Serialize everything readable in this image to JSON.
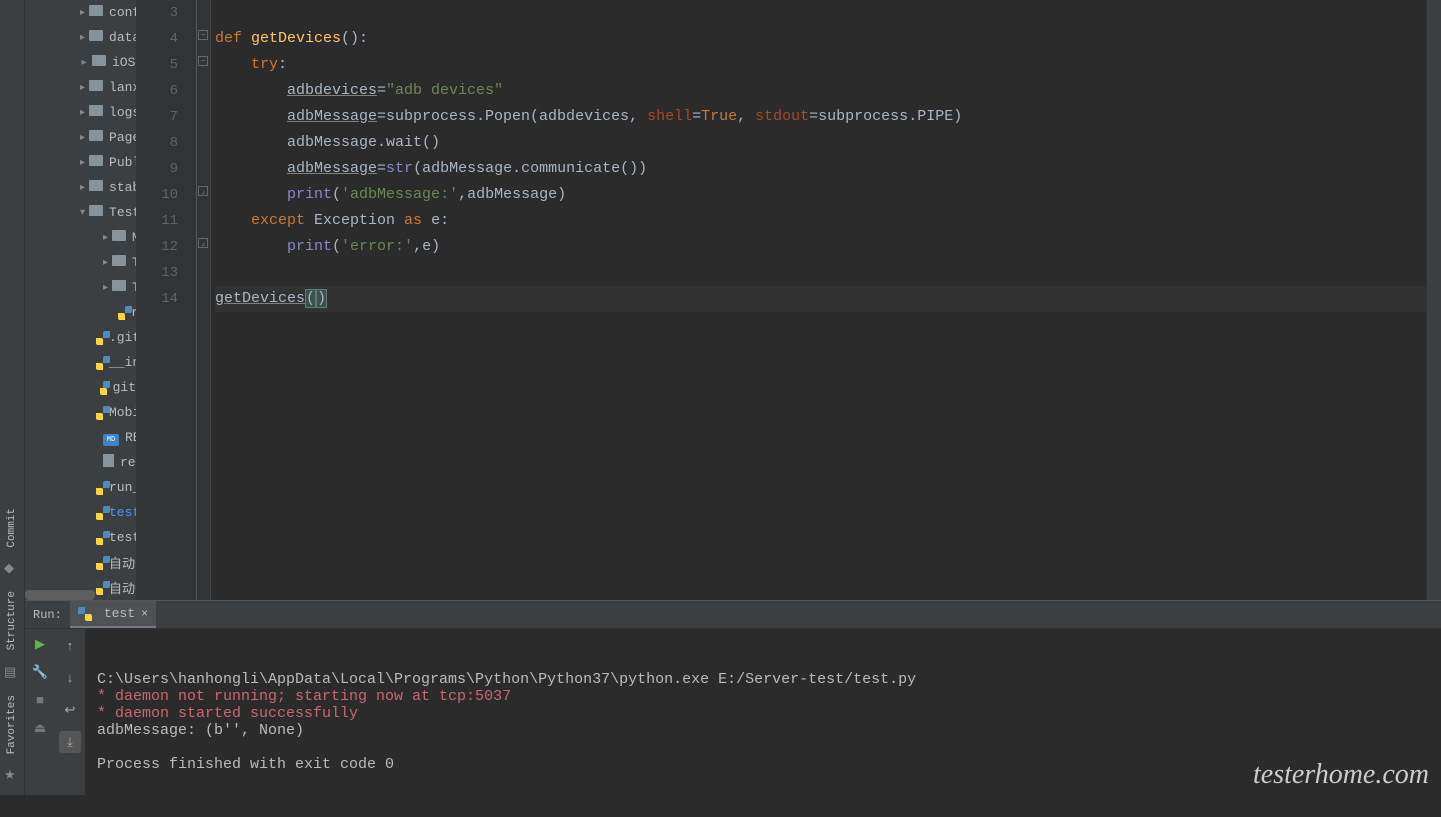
{
  "left_tabs": [
    "Commit",
    "Structure",
    "Favorites"
  ],
  "tree": [
    {
      "indent": 55,
      "chev": "right",
      "icon": "folder",
      "label": "conf"
    },
    {
      "indent": 55,
      "chev": "right",
      "icon": "folder",
      "label": "data"
    },
    {
      "indent": 55,
      "chev": "right",
      "icon": "folder",
      "label": "iOS"
    },
    {
      "indent": 55,
      "chev": "right",
      "icon": "folder",
      "label": "lanxin"
    },
    {
      "indent": 55,
      "chev": "right",
      "icon": "folder",
      "label": "logs"
    },
    {
      "indent": 55,
      "chev": "right",
      "icon": "folder",
      "label": "Page"
    },
    {
      "indent": 55,
      "chev": "right",
      "icon": "folder",
      "label": "Publi"
    },
    {
      "indent": 55,
      "chev": "right",
      "icon": "folder",
      "label": "stabil"
    },
    {
      "indent": 55,
      "chev": "down",
      "icon": "folder",
      "label": "TestS"
    },
    {
      "indent": 78,
      "chev": "right",
      "icon": "folder",
      "label": "M"
    },
    {
      "indent": 78,
      "chev": "right",
      "icon": "folder",
      "label": "Te"
    },
    {
      "indent": 78,
      "chev": "right",
      "icon": "folder",
      "label": "Te"
    },
    {
      "indent": 100,
      "chev": "",
      "icon": "py",
      "label": "ru"
    },
    {
      "indent": 78,
      "chev": "",
      "icon": "py",
      "label": ".gitig"
    },
    {
      "indent": 78,
      "chev": "",
      "icon": "py",
      "label": "__init"
    },
    {
      "indent": 78,
      "chev": "",
      "icon": "py",
      "label": "git"
    },
    {
      "indent": 78,
      "chev": "",
      "icon": "py",
      "label": "Mobi"
    },
    {
      "indent": 78,
      "chev": "",
      "icon": "md",
      "label": "READ"
    },
    {
      "indent": 78,
      "chev": "",
      "icon": "txt",
      "label": "reque"
    },
    {
      "indent": 78,
      "chev": "",
      "icon": "py",
      "label": "run_a"
    },
    {
      "indent": 78,
      "chev": "",
      "icon": "py",
      "label": "test.p",
      "selected": true
    },
    {
      "indent": 78,
      "chev": "",
      "icon": "py",
      "label": "test_c"
    },
    {
      "indent": 78,
      "chev": "",
      "icon": "py",
      "label": "自动化"
    },
    {
      "indent": 78,
      "chev": "",
      "icon": "py",
      "label": "自动化"
    }
  ],
  "line_numbers": [
    "3",
    "4",
    "5",
    "6",
    "7",
    "8",
    "9",
    "10",
    "11",
    "12",
    "13",
    "14"
  ],
  "code_lines": [
    {
      "html": ""
    },
    {
      "html": "<span class='kw'>def </span><span class='fn'>getDevices</span><span class='ident'>():</span>"
    },
    {
      "html": "    <span class='kw'>try</span><span class='ident'>:</span>"
    },
    {
      "html": "        <span class='ident underline'>adbdevices</span><span class='ident'>=</span><span class='str'>\"adb devices\"</span>"
    },
    {
      "html": "        <span class='ident underline'>adbMessage</span><span class='ident'>=subprocess.Popen(adbdevices</span><span class='ident'>,</span><span class='param'> shell</span><span class='ident'>=</span><span class='kw'>True</span><span class='ident'>,</span><span class='param'> stdout</span><span class='ident'>=subprocess.PIPE)</span>"
    },
    {
      "html": "        <span class='ident'>adbMessage.wait()</span>"
    },
    {
      "html": "        <span class='ident underline'>adbMessage</span><span class='ident'>=</span><span class='builtin'>str</span><span class='ident'>(adbMessage.communicate())</span>"
    },
    {
      "html": "        <span class='builtin'>print</span><span class='ident'>(</span><span class='str'>'adbMessage:'</span><span class='ident'>,adbMessage)</span>"
    },
    {
      "html": "    <span class='kw'>except </span><span class='ident'>Exception </span><span class='kw'>as </span><span class='ident'>e:</span>"
    },
    {
      "html": "        <span class='builtin'>print</span><span class='ident'>(</span><span class='str'>'error:'</span><span class='ident'>,e)</span>"
    },
    {
      "html": ""
    },
    {
      "html": "<span class='ident underline'>getDevices</span><span class='caret-paren'>(</span><span class='caret-paren'>)</span>",
      "current": true
    }
  ],
  "run": {
    "panel_label": "Run:",
    "tab_name": "test",
    "console_lines": [
      {
        "text": "C:\\Users\\hanhongli\\AppData\\Local\\Programs\\Python\\Python37\\python.exe E:/Server-test/test.py",
        "cls": ""
      },
      {
        "text": "* daemon not running; starting now at tcp:5037",
        "cls": "red"
      },
      {
        "text": "* daemon started successfully",
        "cls": "red"
      },
      {
        "text": "adbMessage: (b'', None)",
        "cls": ""
      },
      {
        "text": "",
        "cls": ""
      },
      {
        "text": "Process finished with exit code 0",
        "cls": ""
      }
    ]
  },
  "watermark": "testerhome.com"
}
